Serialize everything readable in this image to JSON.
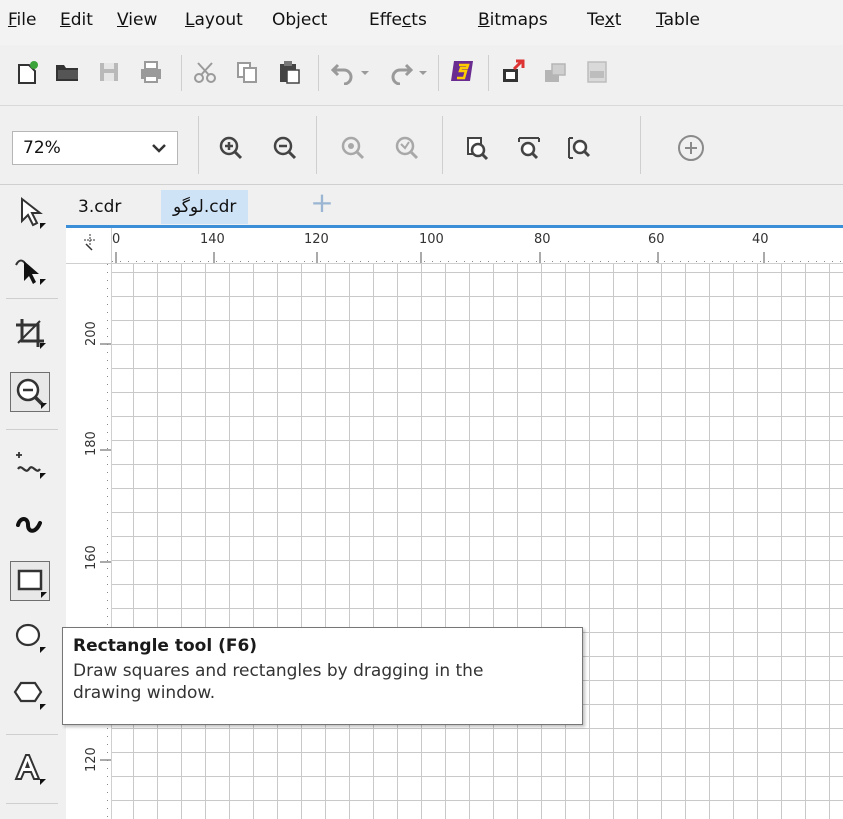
{
  "menubar": {
    "items": [
      {
        "pre": "",
        "mn": "F",
        "post": "ile"
      },
      {
        "pre": "",
        "mn": "E",
        "post": "dit"
      },
      {
        "pre": "",
        "mn": "V",
        "post": "iew"
      },
      {
        "pre": "",
        "mn": "L",
        "post": "ayout"
      },
      {
        "pre": "Ob",
        "mn": "j",
        "post": "ect"
      },
      {
        "pre": "Effe",
        "mn": "c",
        "post": "ts"
      },
      {
        "pre": "",
        "mn": "B",
        "post": "itmaps"
      },
      {
        "pre": "Te",
        "mn": "x",
        "post": "t"
      },
      {
        "pre": "",
        "mn": "T",
        "post": "able"
      }
    ]
  },
  "zoom": {
    "value": "72%"
  },
  "tabs": {
    "doc1": "3.cdr",
    "doc2": "لوگو.cdr",
    "add": "+"
  },
  "rulers": {
    "horizontal": [
      "0",
      "140",
      "120",
      "100",
      "80",
      "60",
      "40"
    ],
    "vertical": [
      "200",
      "180",
      "160",
      "120"
    ]
  },
  "tooltip": {
    "title": "Rectangle tool (F6)",
    "line1": "Draw squares and rectangles by dragging in the",
    "line2": "drawing window."
  },
  "colors": {
    "accent": "#3b8fd9",
    "active_tab": "#cfe3f7",
    "purple_icon": "#6a2c91"
  }
}
